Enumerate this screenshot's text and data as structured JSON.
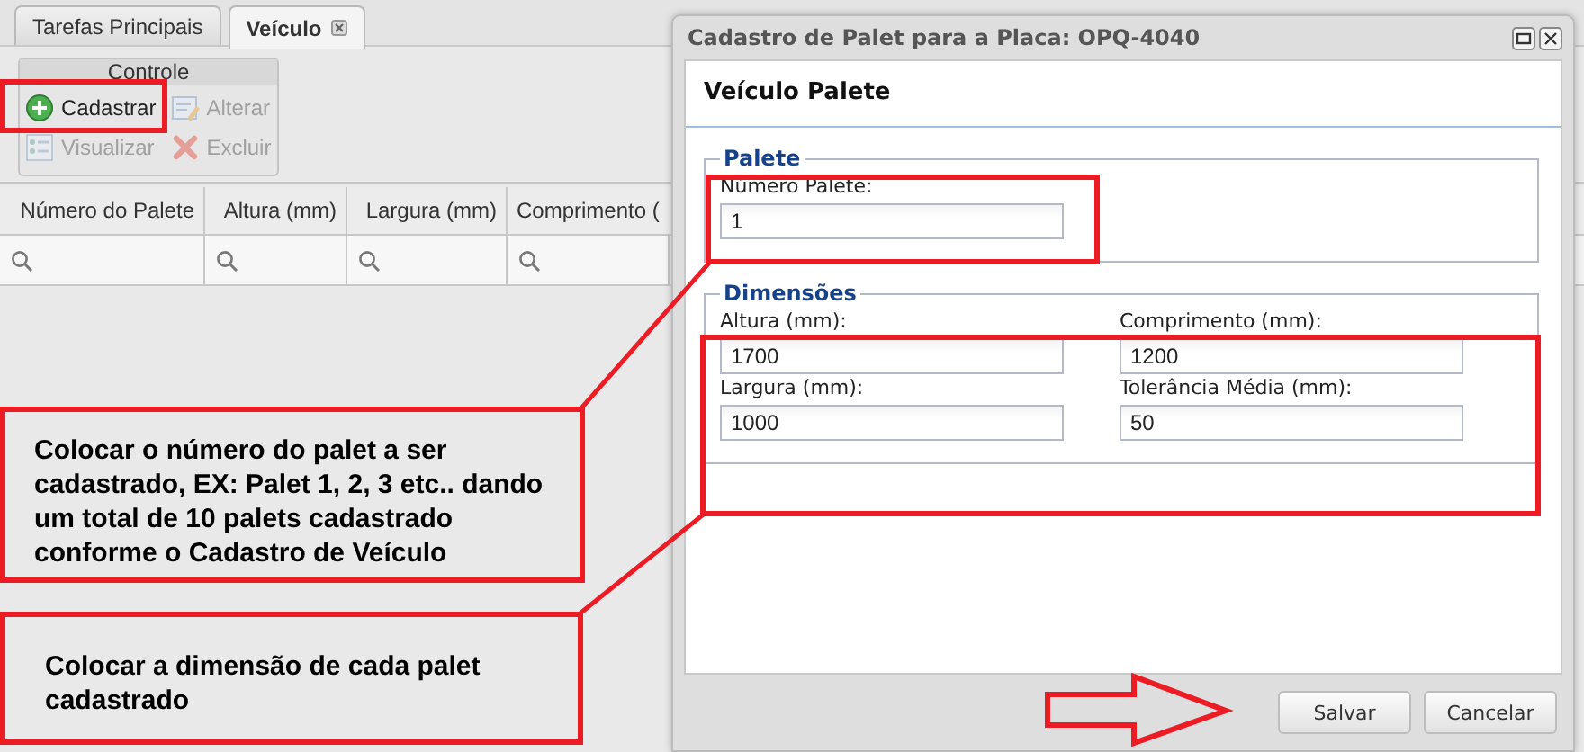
{
  "tabs": [
    {
      "label": "Tarefas Principais",
      "selected": false,
      "closable": false
    },
    {
      "label": "Veículo",
      "selected": true,
      "closable": true
    }
  ],
  "toolbar": {
    "title": "Controle",
    "buttons": [
      {
        "label": "Cadastrar",
        "disabled": false
      },
      {
        "label": "Alterar",
        "disabled": true
      },
      {
        "label": "Visualizar",
        "disabled": true
      },
      {
        "label": "Excluir",
        "disabled": true
      }
    ]
  },
  "table": {
    "columns": [
      "Número do Palete",
      "Altura (mm)",
      "Largura (mm)",
      "Comprimento ("
    ]
  },
  "dialog": {
    "title": "Cadastro de Palet para a Placa: OPQ-4040",
    "header": "Veículo Palete",
    "fieldsets": [
      {
        "legend": "Palete",
        "fields": [
          {
            "label": "Número Palete:",
            "value": "1"
          }
        ]
      },
      {
        "legend": "Dimensões",
        "fields": [
          {
            "label": "Altura (mm):",
            "value": "1700"
          },
          {
            "label": "Comprimento (mm):",
            "value": "1200"
          },
          {
            "label": "Largura (mm):",
            "value": "1000"
          },
          {
            "label": "Tolerância Média (mm):",
            "value": "50"
          }
        ]
      }
    ],
    "buttons": [
      "Salvar",
      "Cancelar"
    ]
  },
  "annotations": [
    {
      "text": "Colocar o número do palet a ser cadastrado, EX: Palet 1, 2, 3 etc.. dando um total de 10 palets cadastrado conforme o Cadastro de Veículo"
    },
    {
      "text": "Colocar a dimensão de cada palet cadastrado"
    }
  ]
}
